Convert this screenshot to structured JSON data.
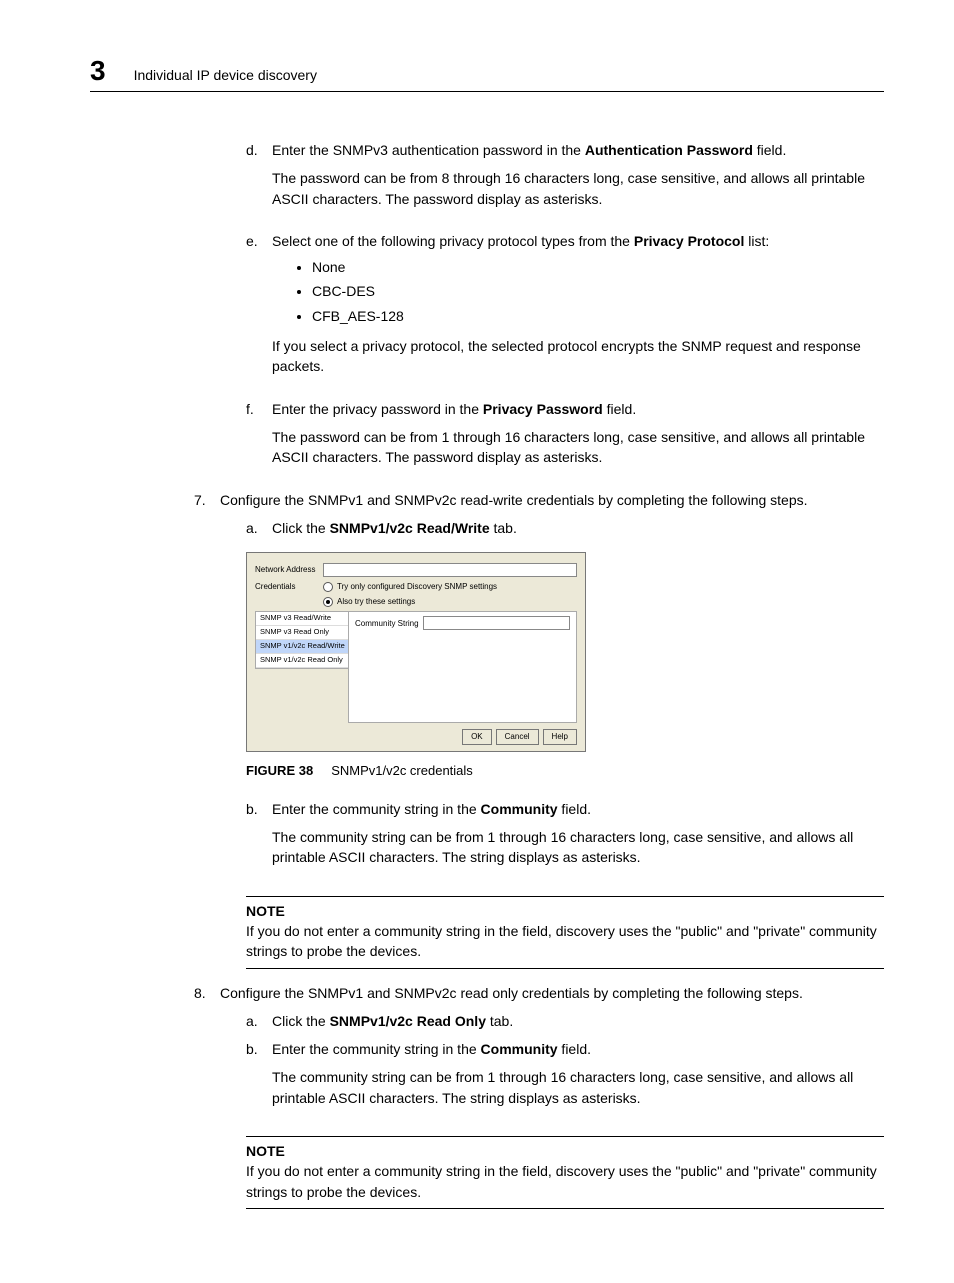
{
  "header": {
    "chapter_number": "3",
    "title": "Individual IP device discovery"
  },
  "step_d": {
    "marker": "d.",
    "text_pre": "Enter the SNMPv3 authentication password in the ",
    "bold": "Authentication Password",
    "text_post": " field.",
    "para": "The password can be from 8 through 16 characters long, case sensitive, and allows all printable ASCII characters. The password display as asterisks."
  },
  "step_e": {
    "marker": "e.",
    "text_pre": "Select one of the following privacy protocol types from the ",
    "bold": "Privacy Protocol",
    "text_post": " list:",
    "bullets": [
      "None",
      "CBC-DES",
      "CFB_AES-128"
    ],
    "para": "If you select a privacy protocol, the selected protocol encrypts the SNMP request and response packets."
  },
  "step_f": {
    "marker": "f.",
    "text_pre": "Enter the privacy password in the ",
    "bold": "Privacy Password",
    "text_post": " field.",
    "para": "The password can be from 1 through 16 characters long, case sensitive, and allows all printable ASCII characters. The password display as asterisks."
  },
  "step_7": {
    "marker": "7.",
    "text": "Configure the SNMPv1 and SNMPv2c read-write credentials by completing the following steps.",
    "a": {
      "marker": "a.",
      "text_pre": "Click the ",
      "bold": "SNMPv1/v2c Read/Write",
      "text_post": " tab."
    },
    "b": {
      "marker": "b.",
      "text_pre": "Enter the community string in the ",
      "bold": "Community",
      "text_post": " field.",
      "para": "The community string can be from 1 through 16 characters long, case sensitive, and allows all printable ASCII characters. The string displays as asterisks."
    },
    "note": {
      "label": "NOTE",
      "text": "If you do not enter a community string in the field, discovery uses the \"public\" and \"private\" community strings to probe the devices."
    }
  },
  "figure": {
    "label": "FIGURE 38",
    "caption": "SNMPv1/v2c credentials",
    "dialog": {
      "network_address_label": "Network Address",
      "credentials_label": "Credentials",
      "radio1": "Try only configured Discovery SNMP settings",
      "radio2": "Also try these settings",
      "tabs": [
        "SNMP v3 Read/Write",
        "SNMP v3 Read Only",
        "SNMP v1/v2c Read/Write",
        "SNMP v1/v2c Read Only"
      ],
      "pane_label": "Community String",
      "buttons": {
        "ok": "OK",
        "cancel": "Cancel",
        "help": "Help"
      }
    }
  },
  "step_8": {
    "marker": "8.",
    "text": "Configure the SNMPv1 and SNMPv2c read only credentials by completing the following steps.",
    "a": {
      "marker": "a.",
      "text_pre": "Click the ",
      "bold": "SNMPv1/v2c Read Only",
      "text_post": " tab."
    },
    "b": {
      "marker": "b.",
      "text_pre": "Enter the community string in the ",
      "bold": "Community",
      "text_post": " field.",
      "para": "The community string can be from 1 through 16 characters long, case sensitive, and allows all printable ASCII characters. The string displays as asterisks."
    },
    "note": {
      "label": "NOTE",
      "text": "If you do not enter a community string in the field, discovery uses the \"public\" and \"private\" community strings to probe the devices."
    }
  }
}
